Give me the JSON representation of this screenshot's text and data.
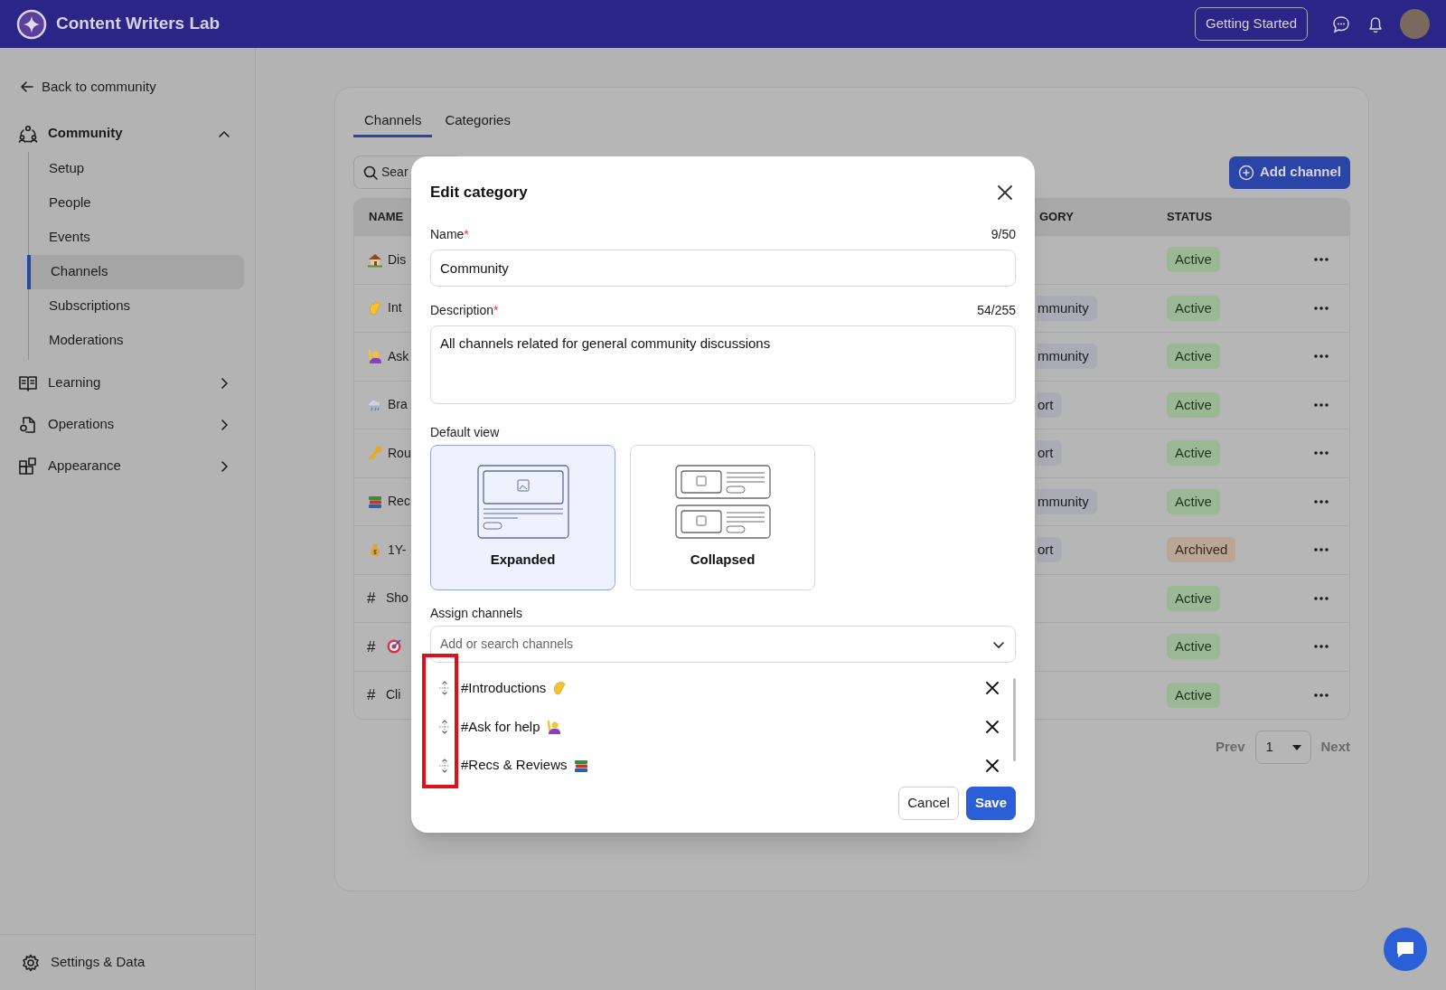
{
  "header": {
    "title": "Content Writers Lab",
    "button": "Getting Started"
  },
  "sidebar": {
    "back": "Back to community",
    "sections": [
      {
        "label": "Community",
        "kind": "people",
        "expanded": true,
        "children": [
          {
            "label": "Setup",
            "selected": false
          },
          {
            "label": "People",
            "selected": false
          },
          {
            "label": "Events",
            "selected": false
          },
          {
            "label": "Channels",
            "selected": true
          },
          {
            "label": "Subscriptions",
            "selected": false
          },
          {
            "label": "Moderations",
            "selected": false
          }
        ]
      },
      {
        "label": "Learning",
        "kind": "book",
        "expanded": false
      },
      {
        "label": "Operations",
        "kind": "doc",
        "expanded": false
      },
      {
        "label": "Appearance",
        "kind": "blocks",
        "expanded": false
      }
    ],
    "footer": "Settings & Data"
  },
  "tabs": [
    {
      "label": "Channels",
      "selected": true
    },
    {
      "label": "Categories",
      "selected": false
    }
  ],
  "search": {
    "placeholder": "Sear"
  },
  "add_button": "Add channel",
  "table": {
    "columns": [
      "NAME",
      "GORY",
      "STATUS"
    ],
    "rows": [
      {
        "kind": "house",
        "name": "Dis",
        "status": {
          "label": "Active",
          "kind": "active"
        }
      },
      {
        "kind": "wave",
        "name": "Int",
        "category": "mmunity",
        "status": {
          "label": "Active",
          "kind": "active"
        }
      },
      {
        "kind": "raised-hand",
        "name": "Ask",
        "category": "mmunity",
        "status": {
          "label": "Active",
          "kind": "active"
        }
      },
      {
        "kind": "rain",
        "name": "Bra",
        "category": "ort",
        "status": {
          "label": "Active",
          "kind": "active"
        }
      },
      {
        "kind": "key",
        "name": "Rou",
        "category": "ort",
        "status": {
          "label": "Active",
          "kind": "active"
        }
      },
      {
        "kind": "books",
        "name": "Rec",
        "category": "mmunity",
        "status": {
          "label": "Active",
          "kind": "active"
        }
      },
      {
        "kind": "money",
        "name": "1Y-",
        "category": "ort",
        "status": {
          "label": "Archived",
          "kind": "archived"
        }
      },
      {
        "prefix": "#",
        "name": "Sho",
        "status": {
          "label": "Active",
          "kind": "active"
        }
      },
      {
        "prefix": "#",
        "kind": "target",
        "status": {
          "label": "Active",
          "kind": "active"
        }
      },
      {
        "prefix": "#",
        "name": "Cli",
        "status": {
          "label": "Active",
          "kind": "active"
        }
      }
    ]
  },
  "pagination": {
    "prev": {
      "label": "Prev",
      "disabled": true
    },
    "page": "1",
    "next": {
      "label": "Next",
      "disabled": true
    }
  },
  "modal": {
    "title": "Edit category",
    "fields": [
      {
        "kind": "input",
        "label": "Name",
        "mark": "*",
        "counter": "9/50",
        "value": "Community"
      },
      {
        "kind": "textarea",
        "label": "Description",
        "mark": "*",
        "counter": "54/255",
        "value": "All channels related for general community discussions"
      }
    ],
    "default_view": {
      "label": "Default view",
      "options": [
        {
          "kind": "expanded",
          "label": "Expanded",
          "selected": true
        },
        {
          "kind": "collapsed",
          "label": "Collapsed",
          "selected": false
        }
      ]
    },
    "assign": {
      "label": "Assign channels",
      "placeholder": "Add or search channels",
      "channels": [
        {
          "label": "#Introductions",
          "kind": "wave"
        },
        {
          "label": "#Ask for help",
          "kind": "raised-hand"
        },
        {
          "label": "#Recs & Reviews",
          "kind": "books"
        }
      ]
    },
    "buttons": [
      {
        "kind": "secondary",
        "label": "Cancel"
      },
      {
        "kind": "primary",
        "label": "Save"
      }
    ]
  }
}
